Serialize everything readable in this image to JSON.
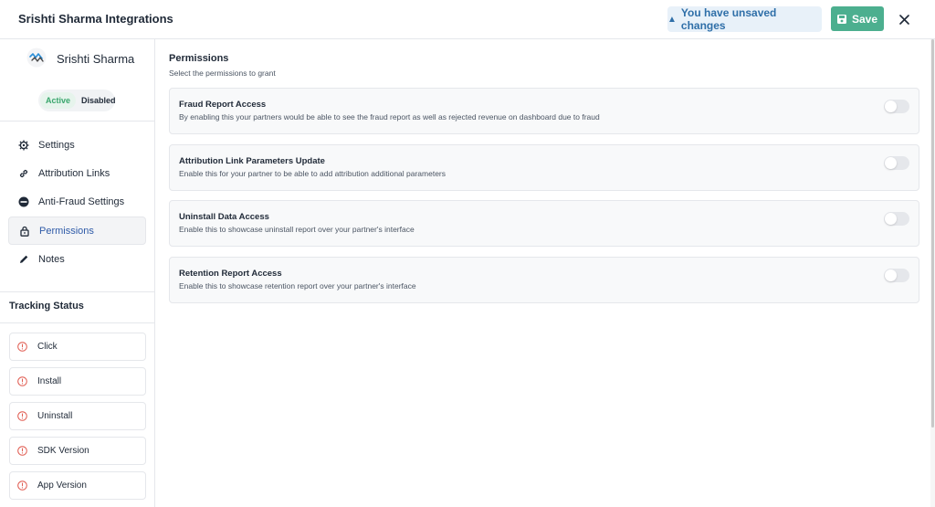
{
  "header": {
    "title": "Srishti Sharma Integrations",
    "unsaved_text": "You have unsaved changes",
    "save_label": "Save"
  },
  "profile": {
    "name": "Srishti Sharma",
    "status_active": "Active",
    "status_disabled": "Disabled"
  },
  "nav": {
    "items": [
      {
        "label": "Settings",
        "icon": "gear-icon"
      },
      {
        "label": "Attribution Links",
        "icon": "link-icon"
      },
      {
        "label": "Anti-Fraud Settings",
        "icon": "block-icon"
      },
      {
        "label": "Permissions",
        "icon": "lock-icon",
        "selected": true
      },
      {
        "label": "Notes",
        "icon": "pencil-icon"
      }
    ]
  },
  "tracking": {
    "title": "Tracking Status",
    "items": [
      {
        "label": "Click"
      },
      {
        "label": "Install"
      },
      {
        "label": "Uninstall"
      },
      {
        "label": "SDK Version"
      },
      {
        "label": "App Version"
      }
    ]
  },
  "permissions": {
    "title": "Permissions",
    "subtitle": "Select the permissions to grant",
    "items": [
      {
        "title": "Fraud Report Access",
        "desc": "By enabling this your partners would be able to see the fraud report as well as rejected revenue on dashboard due to fraud",
        "enabled": false
      },
      {
        "title": "Attribution Link Parameters Update",
        "desc": "Enable this for your partner to be able to add attribution additional parameters",
        "enabled": false
      },
      {
        "title": "Uninstall Data Access",
        "desc": "Enable this to showcase uninstall report over your partner's interface",
        "enabled": false
      },
      {
        "title": "Retention Report Access",
        "desc": "Enable this to showcase retention report over your partner's interface",
        "enabled": false
      }
    ]
  },
  "colors": {
    "accent": "#4caf8f",
    "selected_nav": "#2f5ba8",
    "warning": "#2f6fa8",
    "error": "#e05a4f"
  }
}
